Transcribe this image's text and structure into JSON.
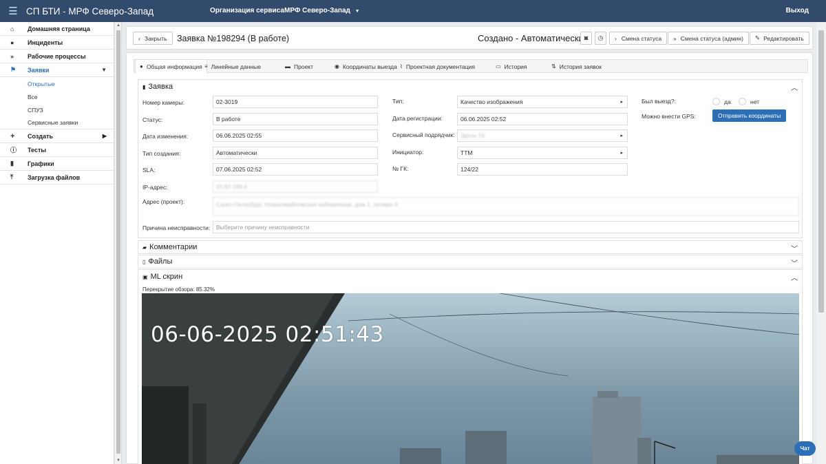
{
  "topbar": {
    "menu_icon": "hamburger-icon",
    "app_title": "СП БТИ - МРФ Северо-Запад",
    "org_label": "Организация сервиса",
    "org_value": "МРФ Северо-Запад",
    "exit": "Выход"
  },
  "sidebar": {
    "items": [
      {
        "label": "Домашняя страница",
        "icon": "home-icon"
      },
      {
        "label": "Инциденты",
        "icon": "bell-icon"
      },
      {
        "label": "Рабочие процессы",
        "icon": "double-chevron-icon"
      },
      {
        "label": "Заявки",
        "icon": "runner-icon"
      },
      {
        "label": "Создать",
        "icon": "plus-icon"
      },
      {
        "label": "Тесты",
        "icon": "info-icon"
      },
      {
        "label": "Графики",
        "icon": "bar-chart-icon"
      },
      {
        "label": "Загрузка файлов",
        "icon": "upload-icon"
      }
    ],
    "subitems": [
      "Открытые",
      "Все",
      "СПУЗ",
      "Сервисные заявки"
    ]
  },
  "header": {
    "close": "Закрыть",
    "title": "Заявка №198294 (В работе)",
    "created": "Создано - Автоматически",
    "status_change": "Смена статуса",
    "status_change_admin": "Смена статуса (админ)",
    "edit": "Редактировать"
  },
  "tabs": [
    "Общая информация",
    "Линейные данные",
    "Проект",
    "Координаты выезда",
    "Проектная документация",
    "История",
    "История заявок"
  ],
  "request": {
    "heading": "Заявка",
    "camera_label": "Номер камеры:",
    "camera_value": "02-3019",
    "status_label": "Статус:",
    "status_value": "В работе",
    "changed_label": "Дата изменения:",
    "changed_value": "06.06.2025  02:55",
    "creation_type_label": "Тип создания:",
    "creation_type_value": "Автоматически",
    "sla_label": "SLA:",
    "sla_value": "07.06.2025  02:52",
    "ip_label": "IP-адрес:",
    "ip_value": "10.62.188.4",
    "address_label": "Адрес (проект):",
    "address_value": "Санкт-Петербург, Новоизмайловская набережная, дом 1, литера А",
    "reason_label": "Причина неисправности:",
    "reason_placeholder": "Выберите причину неисправности",
    "type_label": "Тип:",
    "type_value": "Качество изображения",
    "reg_date_label": "Дата регистрации:",
    "reg_date_value": "06.06.2025  02:52",
    "contractor_label": "Сервисный подрядчик:",
    "contractor_value": "Эргон ТК",
    "initiator_label": "Инициатор:",
    "initiator_value": "ТТМ",
    "gk_label": "№ ГК:",
    "gk_value": "124/22",
    "visit_label": "Был выезд?:",
    "yes": "да",
    "no": "нет",
    "gps_label": "Можно внести GPS:",
    "send_coords": "Отправить координаты"
  },
  "comments": {
    "heading": "Комментарии"
  },
  "files": {
    "heading": "Файлы"
  },
  "ml": {
    "heading": "ML скрин",
    "overlap": "Перекрытие обзора: 85.32%",
    "timestamp": "06-06-2025 02:51:43"
  },
  "chat": "Чат"
}
